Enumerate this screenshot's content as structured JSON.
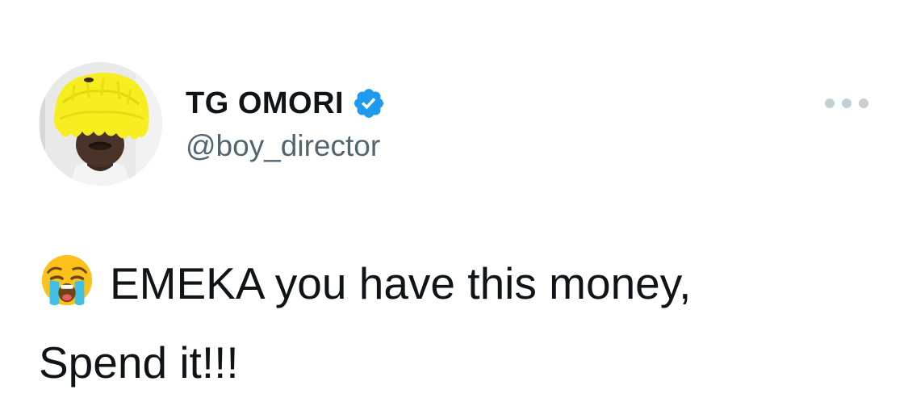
{
  "tweet": {
    "author": {
      "display_name": "TG OMORI",
      "handle": "@boy_director",
      "verified": true,
      "avatar_icon": "avatar-yellow-wig-icon"
    },
    "more_icon": "more-horizontal-icon",
    "text_line1": "EMEKA you have this money,",
    "text_line2": "Spend it!!!",
    "emoji_icon": "loudly-crying-face-emoji",
    "colors": {
      "text": "#0f1419",
      "secondary": "#536471",
      "verified_blue": "#1d9bf0",
      "more_dots": "#c4cfd6"
    }
  }
}
